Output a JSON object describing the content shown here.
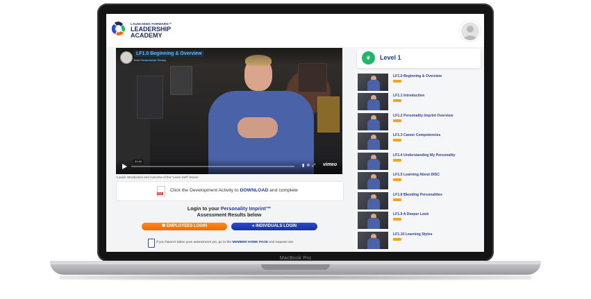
{
  "device": {
    "brand_label": "MacBook Pro"
  },
  "header": {
    "logo_small": "LAUNCHING FORWARD™",
    "logo_line1": "LEADERSHIP",
    "logo_line2": "ACADEMY"
  },
  "video": {
    "title": "LF1.0 Beginning & Overview",
    "from_prefix": "from",
    "from_name": "Commoncor Group",
    "time": "01:44",
    "brand": "vimeo",
    "caption": "A quick introduction and overview of the \"Learn Self\" lesson"
  },
  "download": {
    "pdf_tag": "PDF",
    "text_before": "Click the Development Activity to ",
    "text_link": "DOWNLOAD",
    "text_after": " and complete"
  },
  "login": {
    "title_before": "Login to your ",
    "title_accent": "Personality Imprint™",
    "title_line2": "Assessment Results below",
    "employees_label": "EMPLOYEES LOGIN",
    "individuals_label": "INDIVIDUALS LOGIN",
    "note_before": "If you haven't taken your assessment yet, go to the ",
    "note_link": "MEMBER HOME PAGE",
    "note_after": " and request one."
  },
  "panel": {
    "level_title": "Level 1",
    "lessons": [
      {
        "title": "LF1.0 Beginning & Overview"
      },
      {
        "title": "LF1.1 Introduction"
      },
      {
        "title": "LF1.2 Personality Imprint Overview"
      },
      {
        "title": "LF1.3 Career Competencies"
      },
      {
        "title": "LF1.4 Understanding My Personality"
      },
      {
        "title": "LF1.5 Learning About DISC"
      },
      {
        "title": "LF1.8 Blending Personalities"
      },
      {
        "title": "LF1.9 A Deeper Look"
      },
      {
        "title": "LF1.10 Learning Styles"
      }
    ]
  },
  "colors": {
    "accent_blue": "#1f3a8f",
    "orange": "#f06a0a",
    "green": "#21b66a"
  }
}
